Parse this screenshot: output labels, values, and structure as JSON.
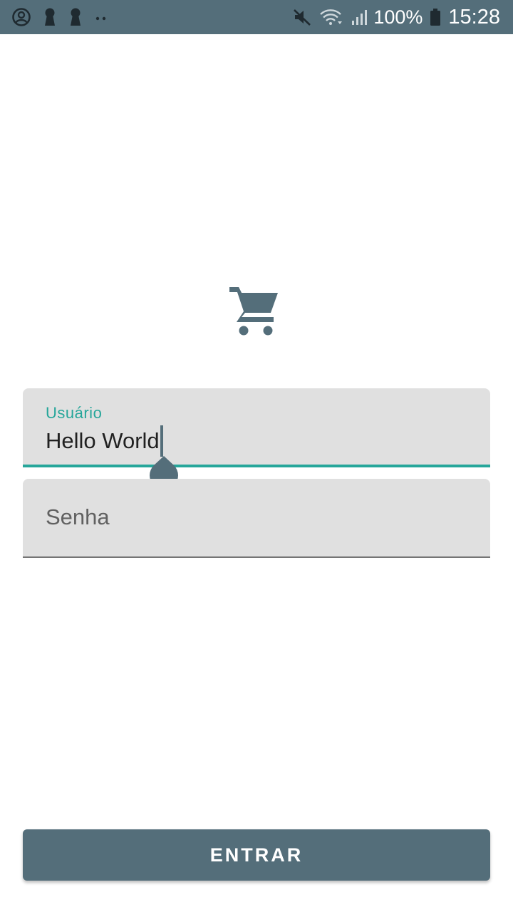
{
  "status_bar": {
    "left_icons": [
      "account-circle-icon",
      "keyhole-icon",
      "keyhole-icon",
      "dots-icon"
    ],
    "right_icons": [
      "mute-icon",
      "wifi-icon",
      "signal-icon",
      "battery-icon"
    ],
    "battery_percent": "100%",
    "time": "15:28"
  },
  "logo": {
    "icon": "shopping-cart-icon"
  },
  "form": {
    "username": {
      "label": "Usuário",
      "value": "Hello World"
    },
    "password": {
      "placeholder": "Senha"
    }
  },
  "actions": {
    "enter_label": "ENTRAR"
  },
  "colors": {
    "primary": "#546e7a",
    "accent": "#26a69a",
    "field_background": "#e0e0e0"
  }
}
